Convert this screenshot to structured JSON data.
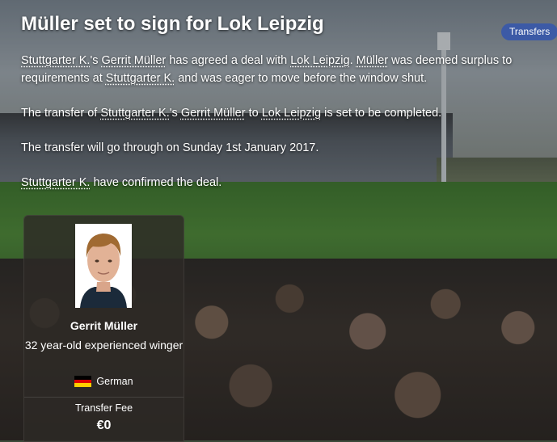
{
  "article": {
    "title": "Müller set to sign for Lok Leipzig",
    "category_badge": "Transfers",
    "p1": {
      "club_from": "Stuttgarter K.",
      "player_possessive": "'s ",
      "player": "Gerrit Müller",
      "mid1": " has agreed a deal with ",
      "club_to": "Lok Leipzig",
      "mid2": ". ",
      "surname": "Müller",
      "mid3": " was deemed surplus to requirements at ",
      "club_from2": "Stuttgarter K.",
      "end": " and was eager to move before the window shut."
    },
    "p2": {
      "start": "The transfer of ",
      "club_from": "Stuttgarter K.",
      "player_possessive": "'s ",
      "player": "Gerrit Müller",
      "mid": " to ",
      "club_to": "Lok Leipzig",
      "end": " is set to be completed."
    },
    "p3": "The transfer will go through on Sunday 1st January 2017.",
    "p4": {
      "club_from": "Stuttgarter K.",
      "end": " have confirmed the deal."
    }
  },
  "player_card": {
    "name": "Gerrit Müller",
    "description": "32 year-old experienced winger",
    "nationality": "German",
    "fee_label": "Transfer Fee",
    "fee_value": "€0"
  },
  "colors": {
    "badge": "#3c5aa6",
    "card": "#2d2a26"
  },
  "icons": {
    "flag": "germany-flag-icon",
    "portrait": "player-portrait"
  }
}
